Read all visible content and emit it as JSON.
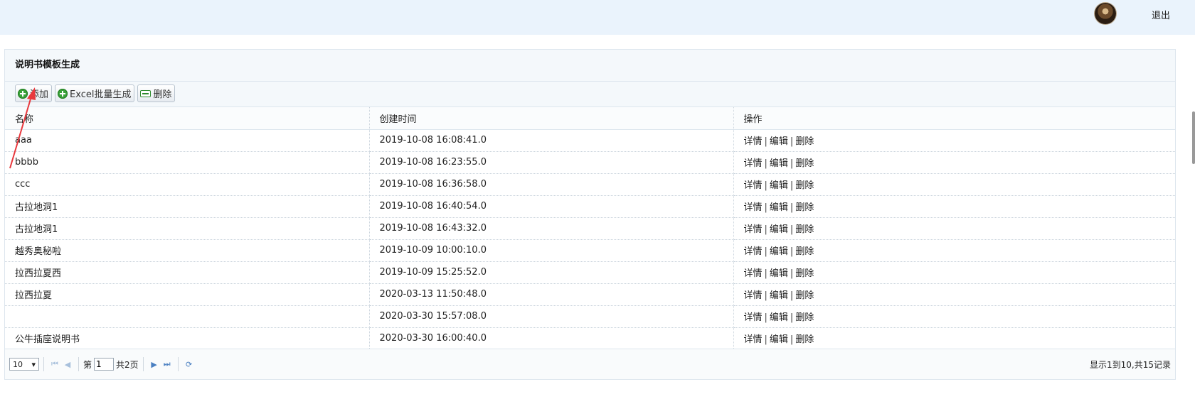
{
  "header": {
    "logout_label": "退出"
  },
  "panel": {
    "title": "说明书模板生成"
  },
  "toolbar": {
    "add_label": "添加",
    "excel_label": "Excel批量生成",
    "delete_label": "删除"
  },
  "table": {
    "columns": [
      "名称",
      "创建时间",
      "操作"
    ],
    "rows": [
      {
        "name": "aaa",
        "created": "2019-10-08 16:08:41.0"
      },
      {
        "name": "bbbb",
        "created": "2019-10-08 16:23:55.0"
      },
      {
        "name": "ccc",
        "created": "2019-10-08 16:36:58.0"
      },
      {
        "name": "古拉地洞1",
        "created": "2019-10-08 16:40:54.0"
      },
      {
        "name": "古拉地洞1",
        "created": "2019-10-08 16:43:32.0"
      },
      {
        "name": "越秀奥秘啦",
        "created": "2019-10-09 10:00:10.0"
      },
      {
        "name": "拉西拉夏西",
        "created": "2019-10-09 15:25:52.0"
      },
      {
        "name": "拉西拉夏",
        "created": "2020-03-13 11:50:48.0"
      },
      {
        "name": "",
        "created": "2020-03-30 15:57:08.0"
      },
      {
        "name": "公牛插座说明书",
        "created": "2020-03-30 16:00:40.0"
      }
    ],
    "actions": {
      "detail": "详情",
      "edit": "编辑",
      "delete": "删除",
      "separator": "|"
    }
  },
  "pager": {
    "page_size": "10",
    "page_prefix": "第",
    "page_value": "1",
    "page_total": "共2页",
    "info": "显示1到10,共15记录"
  },
  "colors": {
    "topbar": "#eaf3fc",
    "annotation_arrow": "#e8383d",
    "add_icon": "#3aa13a"
  }
}
